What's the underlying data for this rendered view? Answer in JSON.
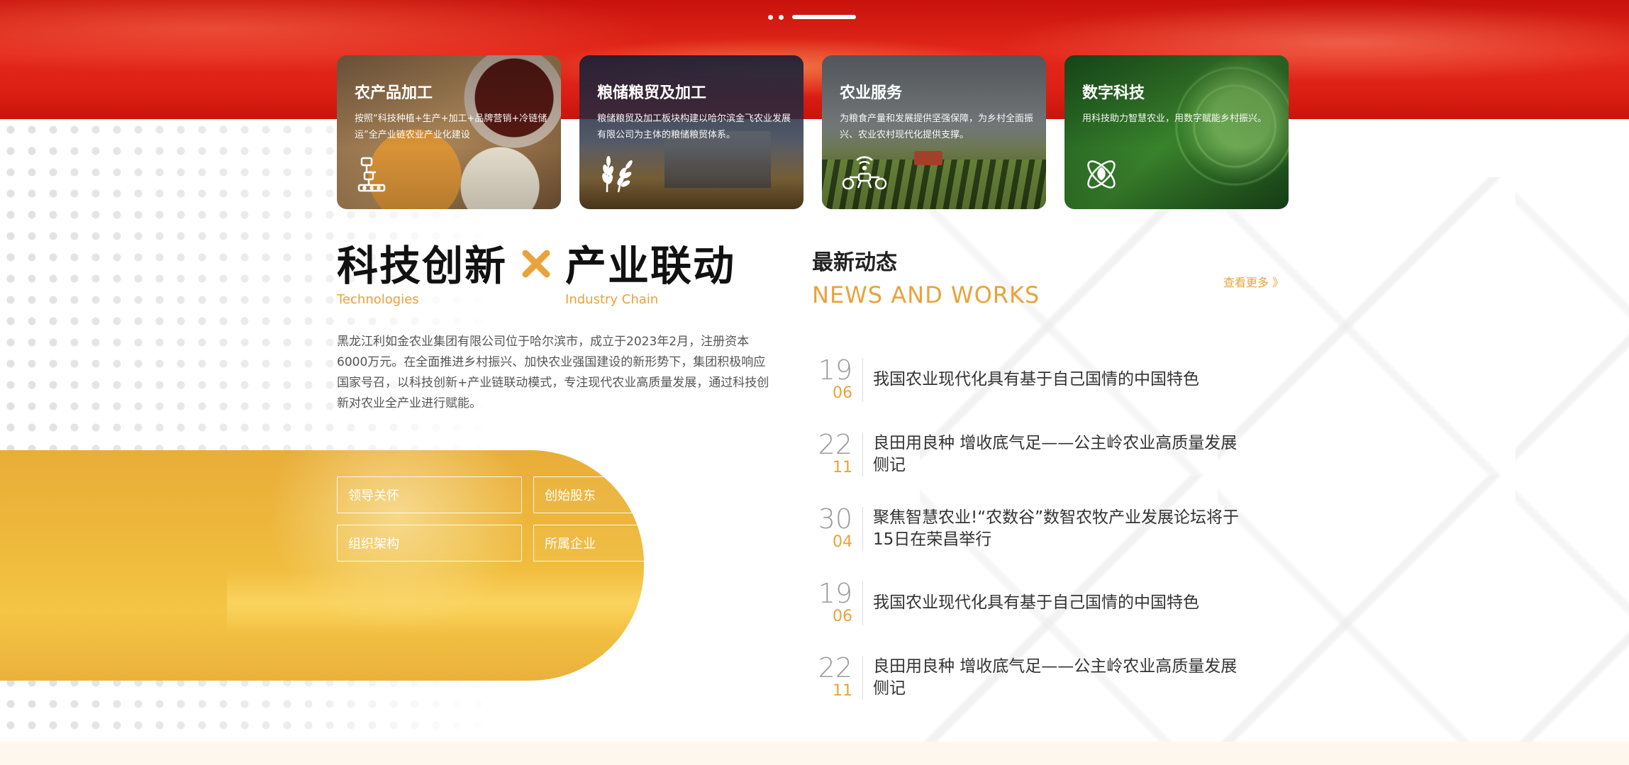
{
  "slider": {
    "dots": 2,
    "active_index": 2
  },
  "cards": [
    {
      "title": "农产品加工",
      "desc": "按照“科技种植+生产+加工+品牌营销+冷链储运”全产业链农业产业化建设",
      "icon": "factory-robot-icon"
    },
    {
      "title": "粮储粮贸及加工",
      "desc": "粮储粮贸及加工板块构建以哈尔滨金飞农业发展有限公司为主体的粮储粮贸体系。",
      "icon": "wheat-icon"
    },
    {
      "title": "农业服务",
      "desc": "为粮食产量和发展提供坚强保障，为乡村全面振兴、农业农村现代化提供支撑。",
      "icon": "drone-icon"
    },
    {
      "title": "数字科技",
      "desc": "用科技助力智慧农业，用数字赋能乡村振兴。",
      "icon": "atom-leaf-icon"
    }
  ],
  "intro": {
    "headline_left": "科技创新",
    "headline_left_sub": "Technologies",
    "headline_right": "产业联动",
    "headline_right_sub": "Industry Chain",
    "body": "黑龙江利如金农业集团有限公司位于哈尔滨市，成立于2023年2月，注册资本6000万元。在全面推进乡村振兴、加快农业强国建设的新形势下，集团积极响应国家号召，以科技创新+产业链联动模式，专注现代农业高质量发展，通过科技创新对农业全产业进行赋能。"
  },
  "links": [
    "领导关怀",
    "创始股东",
    "组织架构",
    "所属企业"
  ],
  "news": {
    "title": "最新动态",
    "subtitle": "NEWS AND WORKS",
    "more": "查看更多 》",
    "items": [
      {
        "day": "19",
        "month": "06",
        "text": "我国农业现代化具有基于自己国情的中国特色"
      },
      {
        "day": "22",
        "month": "11",
        "text": "良田用良种 增收底气足——公主岭农业高质量发展侧记"
      },
      {
        "day": "30",
        "month": "04",
        "text": "聚焦智慧农业!“农数谷”数智农牧产业发展论坛将于15日在荣昌举行"
      },
      {
        "day": "19",
        "month": "06",
        "text": "我国农业现代化具有基于自己国情的中国特色"
      },
      {
        "day": "22",
        "month": "11",
        "text": "良田用良种 增收底气足——公主岭农业高质量发展侧记"
      }
    ]
  },
  "colors": {
    "accent": "#e8a33c",
    "hero_red": "#d81a10",
    "panel_yellow": "#eeb93c"
  }
}
